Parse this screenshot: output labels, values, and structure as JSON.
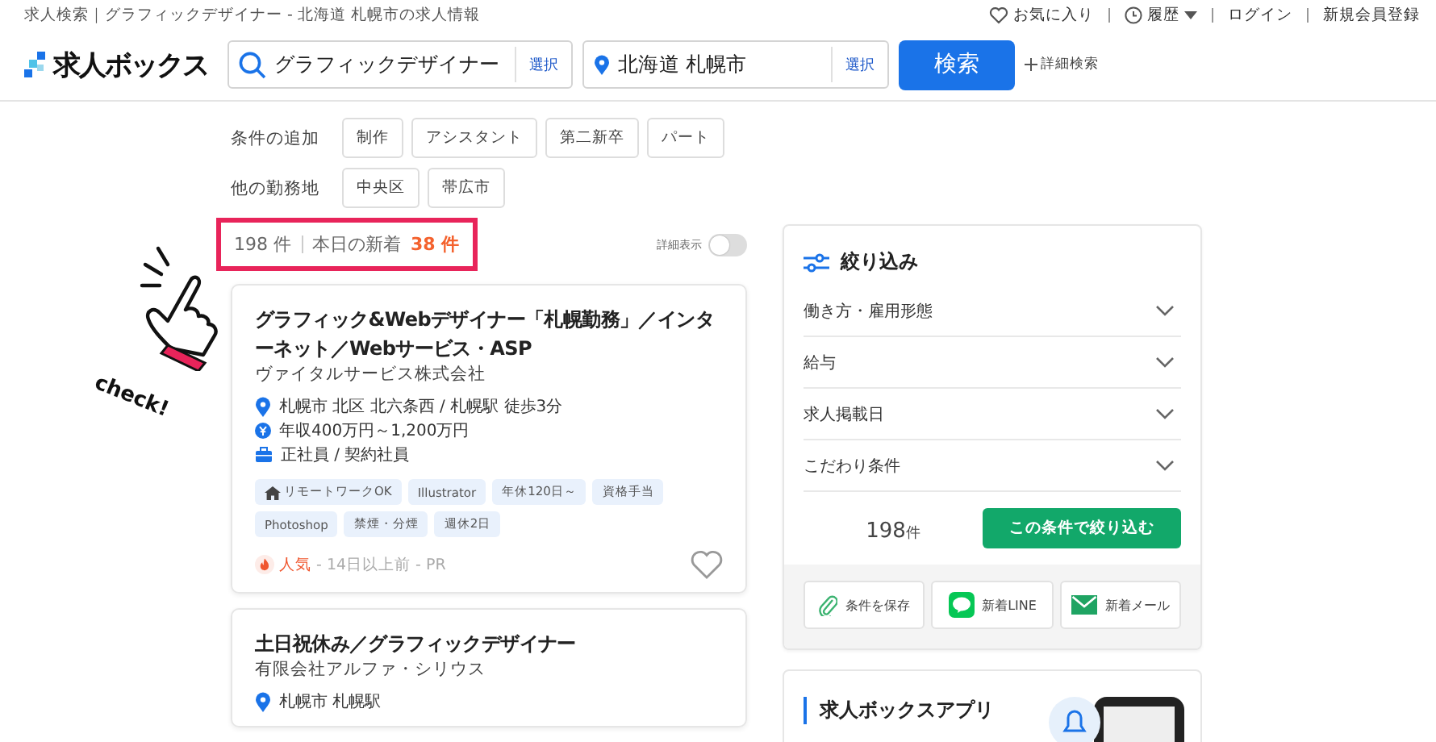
{
  "page_title": "求人検索｜グラフィックデザイナー - 北海道 札幌市の求人情報",
  "header_links": [
    {
      "kind": "favorite",
      "label": "お気に入り"
    },
    {
      "kind": "history",
      "label": "履歴"
    },
    {
      "kind": "plain",
      "label": "ログイン"
    },
    {
      "kind": "plain",
      "label": "新規会員登録"
    }
  ],
  "logo": "求人ボックス",
  "search": {
    "keyword": {
      "value": "グラフィックデザイナー",
      "button": "選択"
    },
    "location": {
      "value": "北海道 札幌市",
      "button": "選択"
    },
    "submit": "検索",
    "advanced": "詳細検索"
  },
  "refine_rows": [
    {
      "label": "条件の追加",
      "chips": [
        "制作",
        "アシスタント",
        "第二新卒",
        "パート"
      ]
    },
    {
      "label": "他の勤務地",
      "chips": [
        "中央区",
        "帯広市"
      ]
    }
  ],
  "results": {
    "count": "198 件",
    "new_label": "本日の新着",
    "new_count": "38 件",
    "detail_toggle": {
      "label": "詳細表示",
      "on": false
    }
  },
  "annotation": "check!",
  "jobs": [
    {
      "title": "グラフィック&Webデザイナー「札幌勤務」／インターネット／Webサービス・ASP",
      "company": "ヴァイタルサービス株式会社",
      "details": [
        {
          "kind": "location",
          "text": "札幌市 北区 北六条西 / 札幌駅 徒歩3分"
        },
        {
          "kind": "salary",
          "text": "年収400万円～1,200万円"
        },
        {
          "kind": "type",
          "text": "正社員 / 契約社員"
        }
      ],
      "tags": [
        {
          "kind": "remote",
          "label": "リモートワークOK"
        },
        {
          "kind": "plain",
          "label": "Illustrator"
        },
        {
          "kind": "plain",
          "label": "年休120日～"
        },
        {
          "kind": "plain",
          "label": "資格手当"
        },
        {
          "kind": "plain",
          "label": "Photoshop"
        },
        {
          "kind": "plain",
          "label": "禁煙・分煙"
        },
        {
          "kind": "plain",
          "label": "週休2日"
        }
      ],
      "popular": "人気",
      "meta": "- 14日以上前 - PR"
    },
    {
      "title": "土日祝休み／グラフィックデザイナー",
      "company": "有限会社アルファ・シリウス",
      "details": [
        {
          "kind": "location",
          "text": "札幌市 札幌駅"
        }
      ]
    }
  ],
  "filter": {
    "title": "絞り込み",
    "items": [
      {
        "label": "働き方・雇用形態",
        "expanded": false
      },
      {
        "label": "給与",
        "expanded": false
      },
      {
        "label": "求人掲載日",
        "expanded": false
      },
      {
        "label": "こだわり条件",
        "expanded": false
      }
    ],
    "count": "198",
    "count_unit": "件",
    "apply": "この条件で絞り込む",
    "actions": [
      {
        "kind": "save",
        "label": "条件を保存"
      },
      {
        "kind": "line",
        "label": "新着LINE"
      },
      {
        "kind": "mail",
        "label": "新着メール"
      }
    ]
  },
  "app_card": {
    "title": "求人ボックスアプリ"
  }
}
